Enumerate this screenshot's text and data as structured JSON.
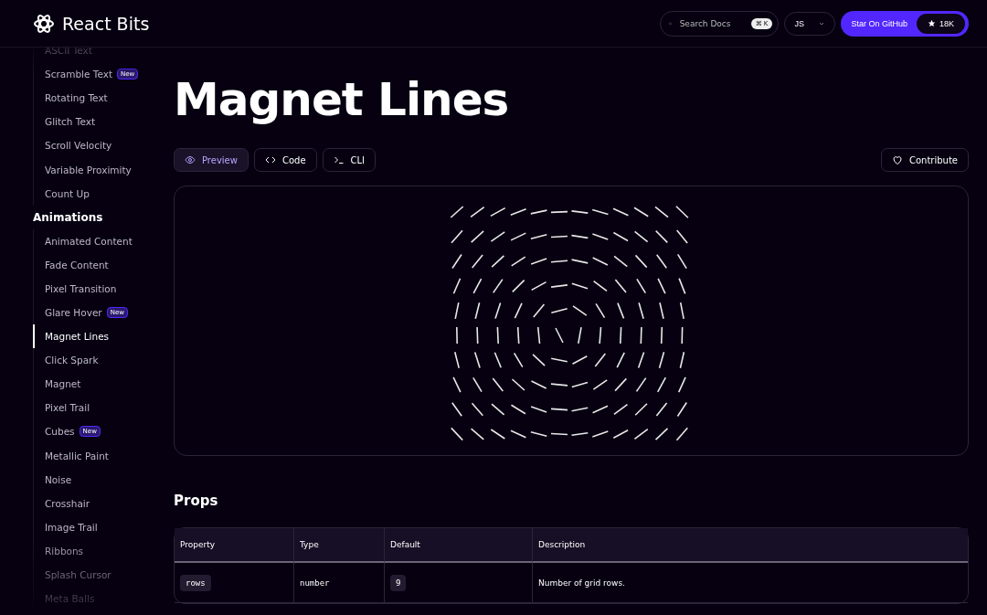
{
  "header": {
    "logo_text": "React Bits",
    "search": {
      "placeholder": "Search Docs",
      "shortcut": "⌘ K"
    },
    "language": "JS",
    "github": {
      "label": "Star On GitHub",
      "stars": "18K"
    }
  },
  "sidebar": {
    "items": [
      {
        "label": "ASCII Text",
        "selected": false
      },
      {
        "label": "Scramble Text",
        "selected": false,
        "badge": "New"
      },
      {
        "label": "Rotating Text",
        "selected": false
      },
      {
        "label": "Glitch Text",
        "selected": false
      },
      {
        "label": "Scroll Velocity",
        "selected": false
      },
      {
        "label": "Variable Proximity",
        "selected": false
      },
      {
        "label": "Count Up",
        "selected": false
      },
      {
        "kind": "heading",
        "label": "Animations"
      },
      {
        "label": "Animated Content",
        "selected": false
      },
      {
        "label": "Fade Content",
        "selected": false
      },
      {
        "label": "Pixel Transition",
        "selected": false
      },
      {
        "label": "Glare Hover",
        "selected": false,
        "badge": "New"
      },
      {
        "label": "Magnet Lines",
        "selected": true
      },
      {
        "label": "Click Spark",
        "selected": false
      },
      {
        "label": "Magnet",
        "selected": false
      },
      {
        "label": "Pixel Trail",
        "selected": false
      },
      {
        "label": "Cubes",
        "selected": false,
        "badge": "New"
      },
      {
        "label": "Metallic Paint",
        "selected": false
      },
      {
        "label": "Noise",
        "selected": false
      },
      {
        "label": "Crosshair",
        "selected": false
      },
      {
        "label": "Image Trail",
        "selected": false
      },
      {
        "label": "Ribbons",
        "selected": false
      },
      {
        "label": "Splash Cursor",
        "selected": false
      },
      {
        "label": "Meta Balls",
        "selected": false
      }
    ]
  },
  "page": {
    "title": "Magnet Lines",
    "tabs": [
      {
        "label": "Preview",
        "selected": true
      },
      {
        "label": "Code",
        "selected": false
      },
      {
        "label": "CLI",
        "selected": false
      }
    ],
    "contribute": "Contribute",
    "props_heading": "Props",
    "table": {
      "columns": [
        "Property",
        "Type",
        "Default",
        "Description"
      ],
      "rows": [
        [
          "rows",
          "number",
          "9",
          "Number of grid rows."
        ]
      ]
    }
  }
}
